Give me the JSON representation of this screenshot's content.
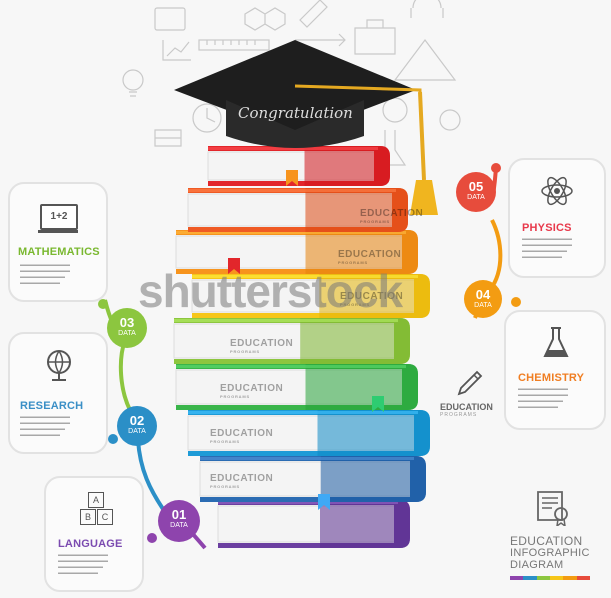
{
  "cap_text": "Congratulation",
  "watermark": "shutterstock",
  "subjects": {
    "mathematics": {
      "title": "MATHEMATICS",
      "icon": "calculator-icon",
      "icon_text": "1+2",
      "color": "#7ab830"
    },
    "research": {
      "title": "RESEARCH",
      "icon": "globe-icon",
      "color": "#3a8fc6"
    },
    "language": {
      "title": "LANGUAGE",
      "icon": "abc-blocks-icon",
      "blocks": [
        "A",
        "B",
        "C"
      ],
      "color": "#7b4bb0"
    },
    "physics": {
      "title": "PHYSICS",
      "icon": "atom-icon",
      "color": "#e8394b"
    },
    "chemistry": {
      "title": "CHEMISTRY",
      "icon": "flask-icon",
      "color": "#f07e22"
    }
  },
  "steps": [
    {
      "num": "01",
      "sub": "DATA",
      "color": "#8e44ad"
    },
    {
      "num": "02",
      "sub": "DATA",
      "color": "#2b8fc7"
    },
    {
      "num": "03",
      "sub": "DATA",
      "color": "#8cc63f"
    },
    {
      "num": "04",
      "sub": "DATA",
      "color": "#f39c12"
    },
    {
      "num": "05",
      "sub": "DATA",
      "color": "#e74c3c"
    }
  ],
  "books": [
    {
      "color": "#e2262b",
      "label": "",
      "sub": ""
    },
    {
      "color": "#ef5a24",
      "label": "EDUCATION",
      "sub": "PROGRAMS"
    },
    {
      "color": "#f7941d",
      "label": "EDUCATION",
      "sub": "PROGRAMS"
    },
    {
      "color": "#f6c619",
      "label": "EDUCATION",
      "sub": "PROGRAMS"
    },
    {
      "color": "#8dc63f",
      "label": "EDUCATION",
      "sub": "PROGRAMS"
    },
    {
      "color": "#39b54a",
      "label": "EDUCATION",
      "sub": "PROGRAMS"
    },
    {
      "color": "#1e9bd7",
      "label": "EDUCATION",
      "sub": "PROGRAMS"
    },
    {
      "color": "#2b6cb3",
      "label": "EDUCATION",
      "sub": "PROGRAMS"
    },
    {
      "color": "#6b3fa0",
      "label": "",
      "sub": ""
    }
  ],
  "side_note": {
    "title": "EDUCATION",
    "sub": "PROGRAMS"
  },
  "footer": {
    "line1": "EDUCATION",
    "line2": "INFOGRAPHIC",
    "line3": "DIAGRAM"
  },
  "footer_colors": [
    "#8e44ad",
    "#2b8fc7",
    "#8cc63f",
    "#f6c619",
    "#f39c12",
    "#e74c3c"
  ]
}
